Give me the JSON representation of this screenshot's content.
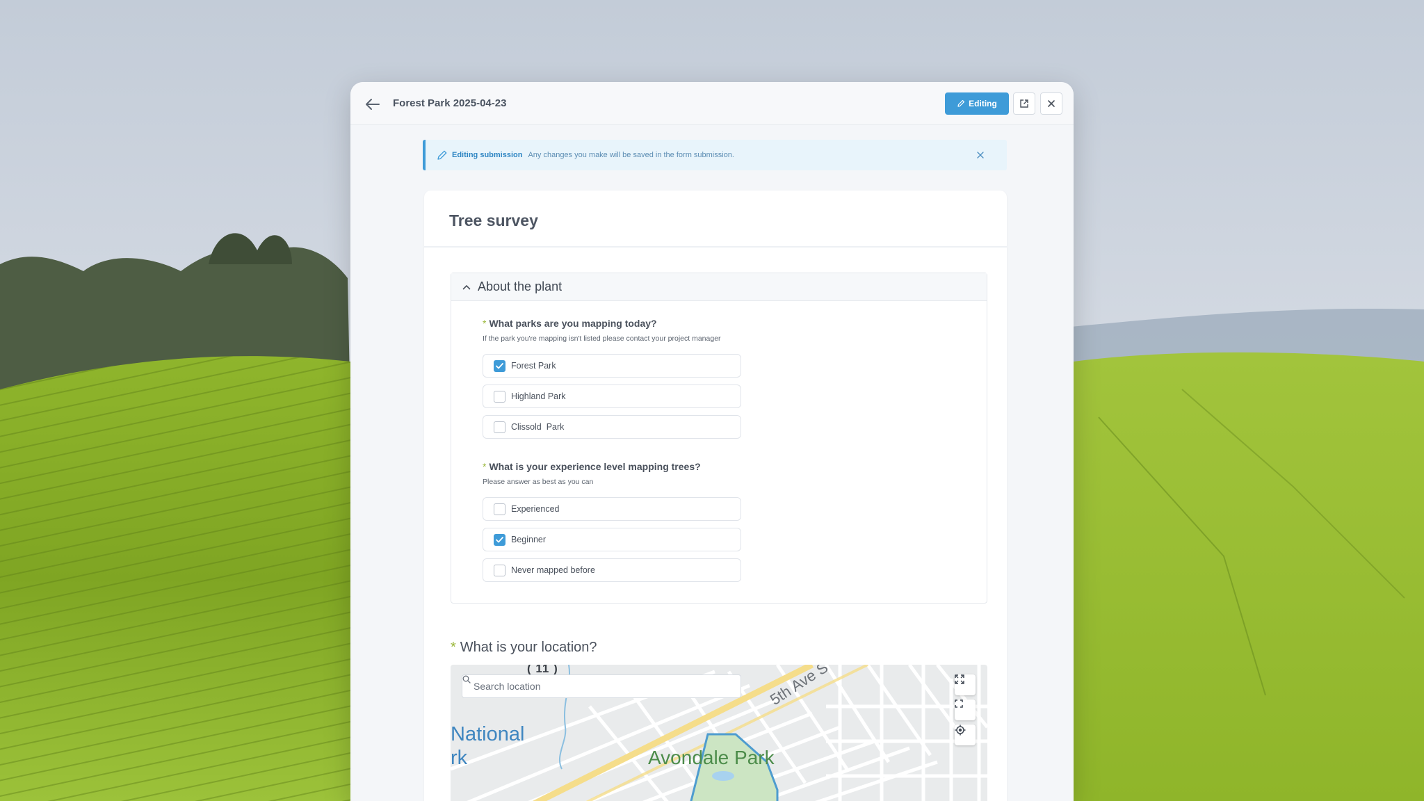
{
  "window": {
    "title": "Forest Park 2025-04-23",
    "editing_label": "Editing"
  },
  "banner": {
    "title": "Editing submission",
    "text": "Any changes you make will be saved in the form submission."
  },
  "form": {
    "title": "Tree survey",
    "section": {
      "title": "About the plant",
      "questions": [
        {
          "label": "What parks are you mapping today?",
          "hint": "If the park you're mapping isn't listed please contact your project manager",
          "options": [
            {
              "label": "Forest Park",
              "checked": true
            },
            {
              "label": "Highland Park",
              "checked": false
            },
            {
              "label": "Clissold  Park",
              "checked": false
            }
          ]
        },
        {
          "label": "What is your experience level mapping trees?",
          "hint": "Please answer as best as you can",
          "options": [
            {
              "label": "Experienced",
              "checked": false
            },
            {
              "label": "Beginner",
              "checked": true
            },
            {
              "label": "Never mapped before",
              "checked": false
            }
          ]
        }
      ]
    },
    "location": {
      "label": "What is your location?",
      "search_placeholder": "Search location",
      "map_labels": {
        "route": "( 11 )",
        "national_1": "National",
        "national_2": "rk",
        "street": "5th Ave S",
        "park": "Avondale Park"
      }
    }
  },
  "colors": {
    "accent": "#3e9bd8",
    "required": "#9ab73a",
    "park_green": "#4c8c4a"
  }
}
